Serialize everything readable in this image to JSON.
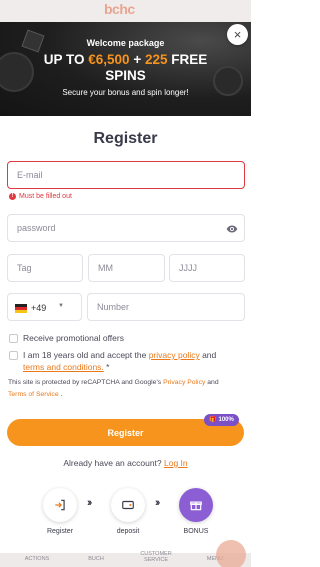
{
  "top_logo": "bchc",
  "banner": {
    "welcome": "Welcome package",
    "headline_prefix": "UP TO ",
    "headline_amount": "€6,500",
    "headline_plus": " + ",
    "headline_spins": "225",
    "headline_free": " FREE",
    "headline_line2": "SPINS",
    "subtitle": "Secure your bonus and spin longer!"
  },
  "close_label": "×",
  "title": "Register",
  "form": {
    "email_placeholder": "E-mail",
    "email_error": "Must be filled out",
    "password_placeholder": "password",
    "day_placeholder": "Tag",
    "month_placeholder": "MM",
    "year_placeholder": "JJJJ",
    "phone_prefix": "+49",
    "phone_placeholder": "Number",
    "promo_label": "Receive promotional offers",
    "terms_prefix": "I am 18 years old and accept the ",
    "terms_privacy": "privacy policy",
    "terms_and": " and",
    "terms_conditions": "terms and conditions.",
    "terms_star": " *",
    "recaptcha_prefix": "This site is protected by reCAPTCHA and Google's ",
    "recaptcha_privacy": "Privacy Policy",
    "recaptcha_and": " and",
    "recaptcha_terms": "Terms of Service",
    "recaptcha_end": " .",
    "register_button": "Register",
    "badge_text": "100%"
  },
  "already_text": "Already have an account?",
  "login_link": "Log In",
  "steps": [
    {
      "label": "Register",
      "icon": "login-icon"
    },
    {
      "label": "deposit",
      "icon": "wallet-icon"
    },
    {
      "label": "BONUS",
      "icon": "gift-icon"
    }
  ],
  "bottom_nav": [
    "ACTIONS",
    "BUCH",
    "CUSTOMER SERVICE",
    "MENU"
  ],
  "colors": {
    "accent": "#f7941d",
    "error": "#e0393e",
    "purple": "#8b5fd3",
    "banner_bg": "#1e1e1e"
  }
}
